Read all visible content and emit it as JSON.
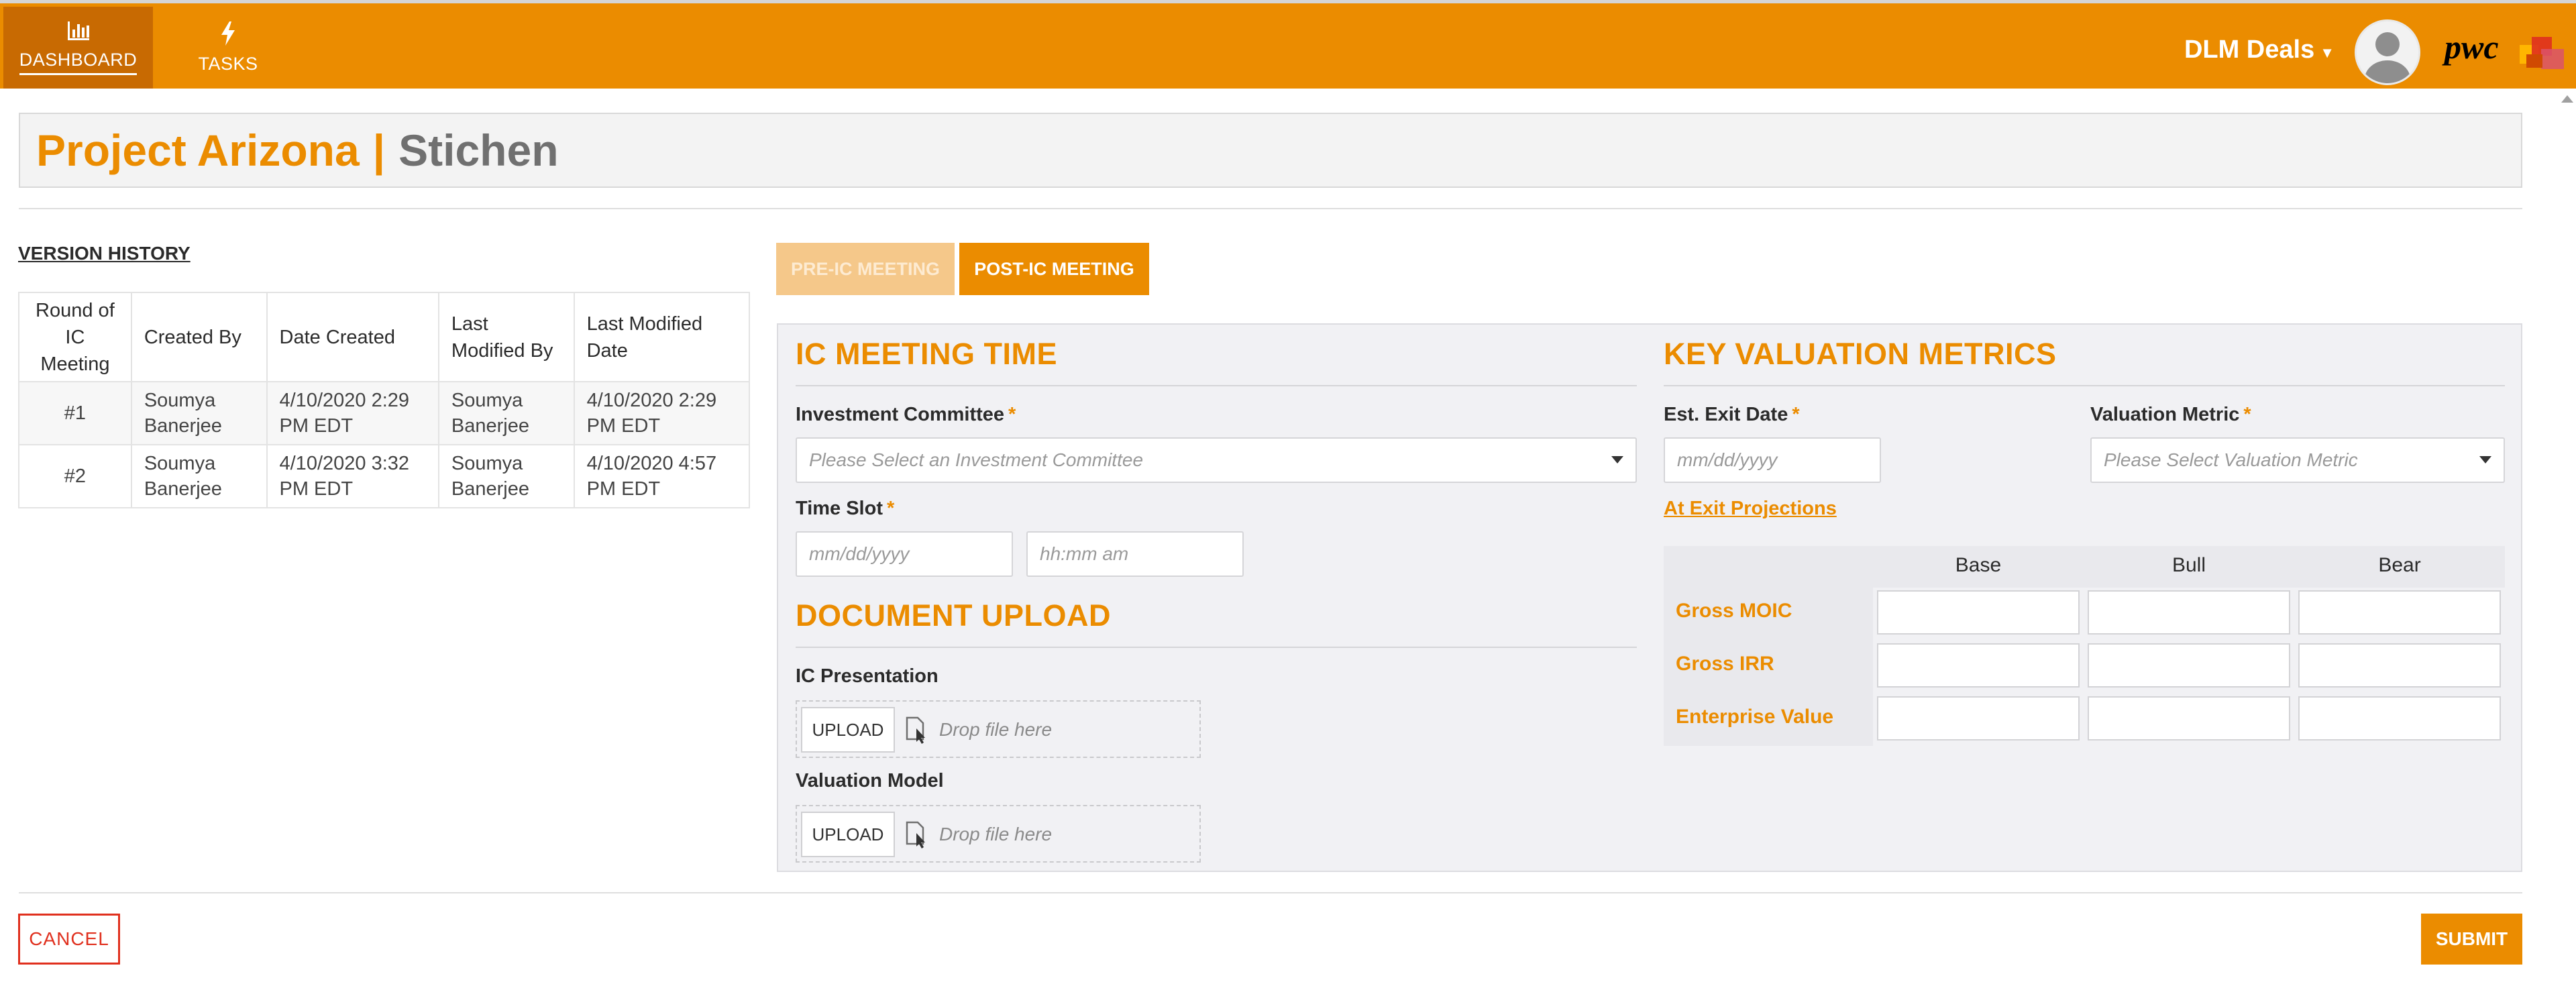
{
  "nav": {
    "dashboard_label": "DASHBOARD",
    "tasks_label": "TASKS",
    "brand": "DLM Deals",
    "logo_text": "pwc"
  },
  "title": {
    "project": "Project Arizona",
    "separator": "|",
    "subtitle": "Stichen"
  },
  "version_history": {
    "title": "VERSION HISTORY",
    "columns": [
      "Round of IC Meeting",
      "Created By",
      "Date Created",
      "Last Modified By",
      "Last Modified Date"
    ],
    "rows": [
      [
        "#1",
        "Soumya Banerjee",
        "4/10/2020 2:29 PM EDT",
        "Soumya Banerjee",
        "4/10/2020 2:29 PM EDT"
      ],
      [
        "#2",
        "Soumya Banerjee",
        "4/10/2020 3:32 PM EDT",
        "Soumya Banerjee",
        "4/10/2020 4:57 PM EDT"
      ]
    ]
  },
  "tabs": {
    "pre": "PRE-IC MEETING",
    "post": "POST-IC MEETING"
  },
  "ic_meeting": {
    "title": "IC MEETING TIME",
    "committee_label": "Investment Committee",
    "committee_placeholder": "Please Select an Investment Committee",
    "timeslot_label": "Time Slot",
    "date_placeholder": "mm/dd/yyyy",
    "time_placeholder": "hh:mm am",
    "required_mark": "*"
  },
  "document_upload": {
    "title": "DOCUMENT UPLOAD",
    "presentation_label": "IC Presentation",
    "model_label": "Valuation Model",
    "upload_label": "UPLOAD",
    "drop_text": "Drop file here"
  },
  "valuation": {
    "title": "KEY VALUATION METRICS",
    "exit_date_label": "Est. Exit Date",
    "exit_date_placeholder": "mm/dd/yyyy",
    "metric_label": "Valuation Metric",
    "metric_placeholder": "Please Select Valuation Metric",
    "projections_link": "At Exit Projections",
    "columns": [
      "Base",
      "Bull",
      "Bear"
    ],
    "rows": [
      "Gross MOIC",
      "Gross IRR",
      "Enterprise Value"
    ]
  },
  "actions": {
    "cancel": "CANCEL",
    "submit": "SUBMIT"
  },
  "colors": {
    "accent": "#eb8c00",
    "accent_dark": "#c86a02",
    "cancel": "#e0301e"
  }
}
